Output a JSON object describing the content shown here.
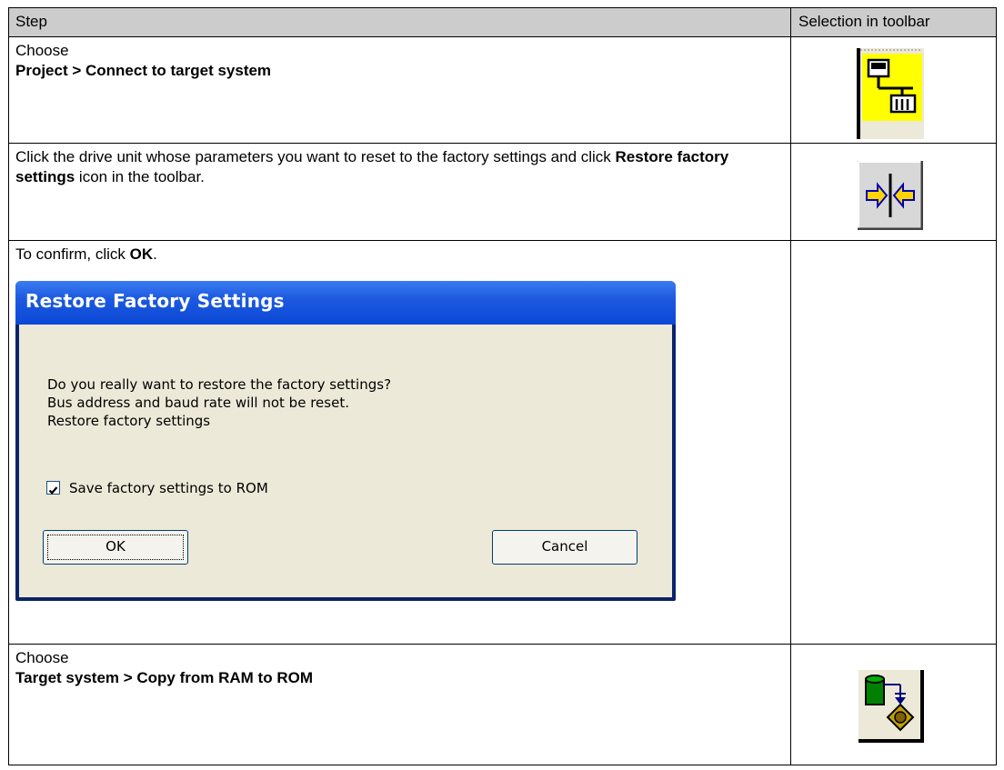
{
  "table": {
    "headers": {
      "step": "Step",
      "toolbar": "Selection in toolbar"
    },
    "rows": [
      {
        "step_prefix": "Choose",
        "step_bold": "Project > Connect to target system",
        "icon": "connect-to-target-system-icon"
      },
      {
        "step_text": "Click the drive unit whose parameters you want to reset to the factory settings and click ",
        "step_bold": "Restore factory settings",
        "step_suffix": " icon in the toolbar.",
        "icon": "restore-factory-settings-icon"
      },
      {
        "step_text": "To confirm, click ",
        "step_bold": "OK",
        "step_suffix": "."
      },
      {
        "step_prefix": "Choose",
        "step_bold": "Target system > Copy from RAM to ROM",
        "icon": "copy-ram-to-rom-icon"
      }
    ]
  },
  "dialog": {
    "title": "Restore Factory Settings",
    "message_lines": [
      "Do you really want to restore the factory settings?",
      "Bus address and baud rate will not be reset.",
      "Restore factory settings"
    ],
    "checkbox_label": "Save factory settings to ROM",
    "checkbox_checked": true,
    "ok_label": "OK",
    "cancel_label": "Cancel"
  },
  "colors": {
    "header_bg": "#cccccc",
    "icon_yellow": "#ffff00",
    "dialog_title_blue": "#0b48d6",
    "dialog_body": "#ece9d8"
  }
}
